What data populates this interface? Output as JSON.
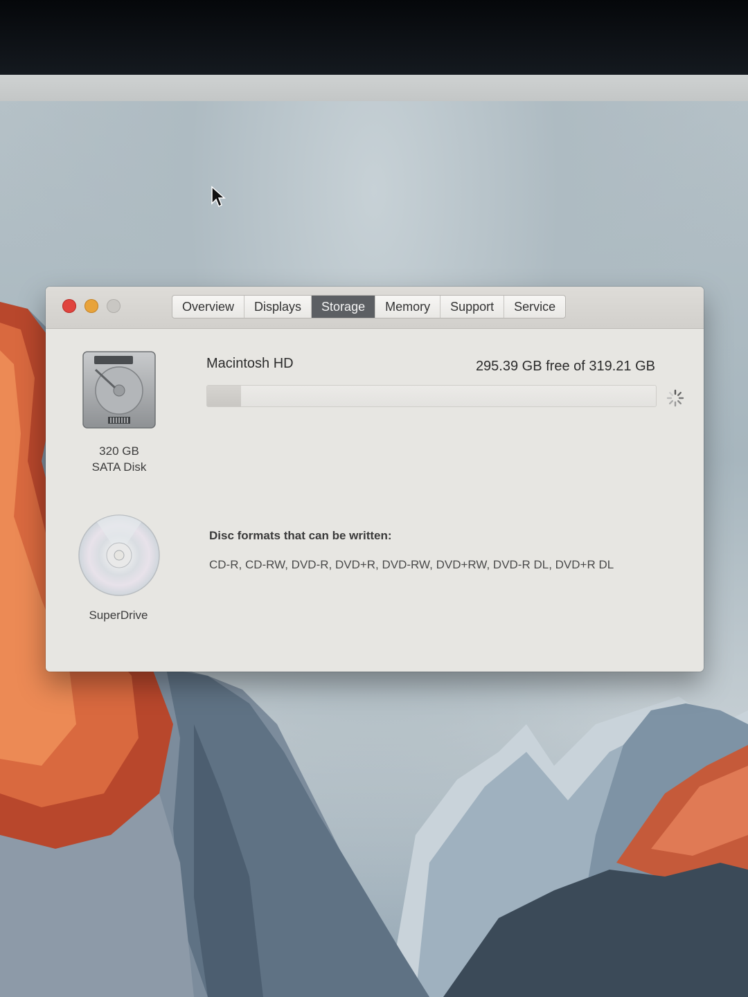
{
  "window": {
    "tabs": [
      {
        "label": "Overview"
      },
      {
        "label": "Displays"
      },
      {
        "label": "Storage"
      },
      {
        "label": "Memory"
      },
      {
        "label": "Support"
      },
      {
        "label": "Service"
      }
    ],
    "active_tab": "Storage"
  },
  "storage": {
    "disk": {
      "capacity_label": "320 GB",
      "type_label": "SATA Disk",
      "icon": "hard-drive-icon"
    },
    "volume": {
      "name": "Macintosh HD",
      "free_text": "295.39 GB free of 319.21 GB",
      "used_fraction": 0.075
    },
    "optical": {
      "name": "SuperDrive",
      "icon": "optical-disc-icon",
      "formats_heading": "Disc formats that can be written:",
      "formats": "CD-R, CD-RW, DVD-R, DVD+R, DVD-RW, DVD+RW, DVD-R DL, DVD+R DL"
    }
  },
  "colors": {
    "close": "#e0443e",
    "minimize": "#e8a33b",
    "zoom_disabled": "#c9c7c3",
    "active_tab_bg": "#5c5f63"
  }
}
